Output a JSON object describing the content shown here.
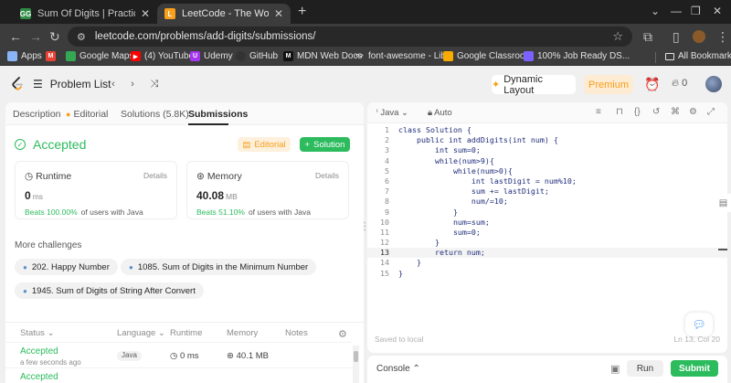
{
  "browser": {
    "tabs": [
      {
        "title": "Sum Of Digits | Practice | Geeks",
        "favicon": "GG",
        "color": "#2f8d46"
      },
      {
        "title": "LeetCode - The World's Leading",
        "favicon": "L",
        "color": "#f89f1b"
      }
    ],
    "url": "leetcode.com/problems/add-digits/submissions/",
    "bookmarks": [
      {
        "label": "Apps",
        "icon": "grid-icon",
        "color": "#8ab4f8"
      },
      {
        "label": "",
        "icon": "gmail-icon",
        "color": "#ea4335"
      },
      {
        "label": "Google Maps",
        "icon": "maps-icon",
        "color": "#34a853"
      },
      {
        "label": "(4) YouTube",
        "icon": "youtube-icon",
        "color": "#ff0000"
      },
      {
        "label": "Udemy",
        "icon": "udemy-icon",
        "color": "#a435f0"
      },
      {
        "label": "GitHub",
        "icon": "github-icon",
        "color": "#333333"
      },
      {
        "label": "MDN Web Docs",
        "icon": "mdn-icon",
        "color": "#111111"
      },
      {
        "label": "font-awesome - Lib...",
        "icon": "code-icon",
        "color": "#e3e3e3"
      },
      {
        "label": "Google Classroom",
        "icon": "classroom-icon",
        "color": "#f9ab00"
      },
      {
        "label": "100% Job Ready DS...",
        "icon": "shield-icon",
        "color": "#7b61ff"
      }
    ],
    "all_bookmarks": "All Bookmarks"
  },
  "nav": {
    "problem_list": "Problem List",
    "dynamic_layout": "Dynamic Layout",
    "premium": "Premium",
    "streak": "0"
  },
  "left": {
    "tabs": [
      "Description",
      "Editorial",
      "Solutions (5.8K)",
      "Submissions"
    ],
    "status": "Accepted",
    "editorial_btn": "Editorial",
    "solution_btn": "Solution",
    "runtime": {
      "label": "Runtime",
      "details": "Details",
      "value": "0",
      "unit": "ms",
      "beats": "Beats 100.00%",
      "suffix": "of users with Java"
    },
    "memory": {
      "label": "Memory",
      "details": "Details",
      "value": "40.08",
      "unit": "MB",
      "beats": "Beats 51.10%",
      "suffix": "of users with Java"
    },
    "more_challenges": "More challenges",
    "challenges": [
      "202. Happy Number",
      "1085. Sum of Digits in the Minimum Number",
      "1945. Sum of Digits of String After Convert"
    ],
    "table": {
      "headers": [
        "Status",
        "Language",
        "Runtime",
        "Memory",
        "Notes"
      ],
      "rows": [
        {
          "status": "Accepted",
          "time": "a few seconds ago",
          "language": "Java",
          "runtime": "0 ms",
          "memory": "40.1 MB"
        },
        {
          "status": "Accepted",
          "time": "",
          "language": "",
          "runtime": "",
          "memory": ""
        }
      ]
    }
  },
  "editor": {
    "language": "Java",
    "mode": "Auto",
    "lines": [
      "class Solution {",
      "    public int addDigits(int num) {",
      "        int sum=0;",
      "        while(num>9){",
      "            while(num>0){",
      "                int lastDigit = num%10;",
      "                sum += lastDigit;",
      "                num/=10;",
      "            }",
      "            num=sum;",
      "            sum=0;",
      "        }",
      "        return num;",
      "    }",
      "}"
    ],
    "current_line": 13,
    "saved": "Saved to local",
    "position": "Ln 13, Col 20"
  },
  "console": {
    "label": "Console",
    "run": "Run",
    "submit": "Submit"
  }
}
